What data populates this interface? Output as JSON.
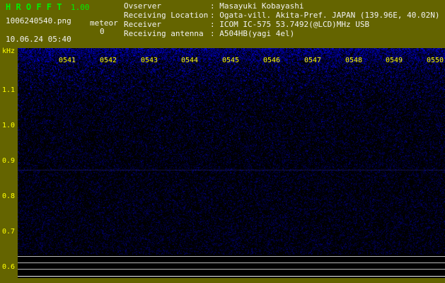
{
  "app": {
    "title": "H R O F F T",
    "version": "1.00",
    "filename": "1006240540.png",
    "mode_label": "meteor",
    "meteor_count": "0",
    "timestamp": "10.06.24 05:40"
  },
  "station": {
    "rows": [
      {
        "label": "Ovserver",
        "value": ": Masayuki Kobayashi"
      },
      {
        "label": "Receiving Location",
        "value": ": Ogata-vill. Akita-Pref. JAPAN (139.96E, 40.02N)"
      },
      {
        "label": "Receiver",
        "value": ": ICOM IC-575 53.7492(@LCD)MHz USB"
      },
      {
        "label": "Receiving antenna",
        "value": ": A504HB(yagi 4el)"
      }
    ]
  },
  "spectrogram": {
    "freq_axis_unit": "kHz",
    "freq_labels": [
      "1.1",
      "1.0",
      "0.9",
      "0.8",
      "0.7",
      "0.6"
    ],
    "time_labels": [
      "0541",
      "0542",
      "0543",
      "0544",
      "0545",
      "0546",
      "0547",
      "0548",
      "0549",
      "0550"
    ],
    "colors": {
      "frame": "#646400",
      "plot_background": "#000000",
      "noise": "#0000ff",
      "axis_text": "#ffff00",
      "title_text": "#00ee00",
      "header_text": "#f2f2f2",
      "level_grid": "#b8b8b8"
    }
  }
}
